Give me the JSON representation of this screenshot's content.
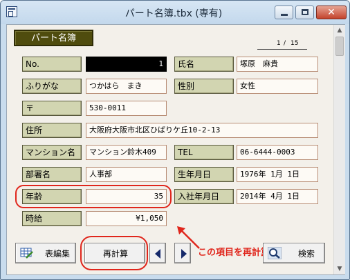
{
  "window": {
    "title": "パート名簿.tbx (専有)",
    "icons": {
      "app": "database-window-icon",
      "minimize": "minimize-icon",
      "maximize": "maximize-icon",
      "close": "close-icon"
    },
    "close_glyph": "✕"
  },
  "form": {
    "header_label": "パート名簿",
    "page": {
      "current": "1",
      "separator": "/",
      "total": "15"
    },
    "fields": {
      "no": {
        "label": "No.",
        "value": "1"
      },
      "name": {
        "label": "氏名",
        "value": "塚原　麻貴"
      },
      "furigana": {
        "label": "ふりがな",
        "value": "つかはら　まき"
      },
      "gender": {
        "label": "性別",
        "value": "女性"
      },
      "postal": {
        "label": "〒",
        "value": "530-0011"
      },
      "address": {
        "label": "住所",
        "value": "大阪府大阪市北区ひばりケ丘10-2-13"
      },
      "mansion": {
        "label": "マンション名",
        "value": "マンション鈴木409"
      },
      "tel": {
        "label": "TEL",
        "value": "06-6444-0003"
      },
      "department": {
        "label": "部署名",
        "value": "人事部"
      },
      "birthdate": {
        "label": "生年月日",
        "value": "1976年 1月 1日"
      },
      "age": {
        "label": "年齢",
        "value": "35"
      },
      "join_date": {
        "label": "入社年月日",
        "value": "2014年 4月 1日"
      },
      "hourly_wage": {
        "label": "時給",
        "value": "¥1,050"
      }
    }
  },
  "toolbar": {
    "table_edit_label": "表編集",
    "recalc_label": "再計算",
    "search_label": "検索",
    "icons": {
      "table_edit": "table-edit-icon",
      "prev": "previous-record-icon",
      "next": "next-record-icon",
      "search": "search-magnifier-icon"
    }
  },
  "annotation": {
    "text": "この項目を再計算",
    "color": "#e0261c"
  },
  "colors": {
    "label_bg": "#d2d5b1",
    "field_border": "#b78c74",
    "header_bg": "#4f4c0e",
    "form_bg": "#f3f0ea",
    "nav_arrow": "#15296b"
  }
}
